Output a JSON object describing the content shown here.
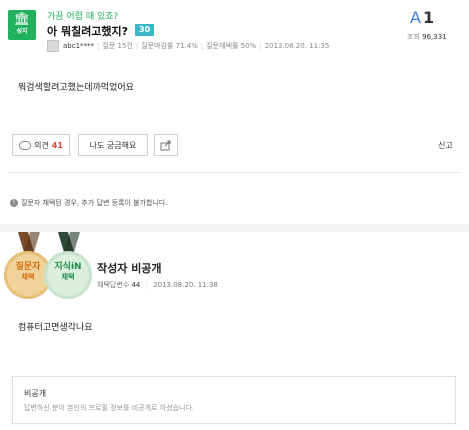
{
  "question": {
    "category_badge": {
      "label": "성지",
      "icon": "temple-icon",
      "color": "#1fb15b"
    },
    "category_text": "가끔 어렵 때 있죠?",
    "title": "아 뭐칠려고했지?",
    "bounty": "30",
    "author": "abc1****",
    "questions_count": "질문 15건",
    "closing_rate": "질문마감률 71.4%",
    "adoption_rate": "질문채택률 50%",
    "date": "2013.08.20. 11:35",
    "answers_letter": "A",
    "answers_count": "1",
    "views_label": "조회",
    "views_value": "96,331",
    "body": "뭐검색할려고했는데까먹었어요"
  },
  "actions": {
    "opinion_label": "의견",
    "opinion_count": "41",
    "curious_label": "나도 궁금해요",
    "share_icon": "share-icon",
    "report_label": "신고"
  },
  "notice": {
    "text": "질문자 채택된 경우, 추가 답변 등록이 불가합니다."
  },
  "answer": {
    "medal_questioner_line1": "질문자",
    "medal_questioner_line2": "채택",
    "medal_jisik_line1": "지식iN",
    "medal_jisik_line2": "채택",
    "writer": "작성자 비공개",
    "adopted_count_label": "채택답변수",
    "adopted_count_value": "44",
    "date": "2013.08.20. 11:38",
    "body": "컴퓨터고면생각나요"
  },
  "private": {
    "title": "비공개",
    "desc": "답변하신 분이 본인의 프로필 정보를 비공개로 하셨습니다."
  },
  "colors": {
    "green": "#1fb15b",
    "accent_blue": "#3b7ddd",
    "bounty": "#3bb6c6",
    "count_red": "#e4483a"
  }
}
